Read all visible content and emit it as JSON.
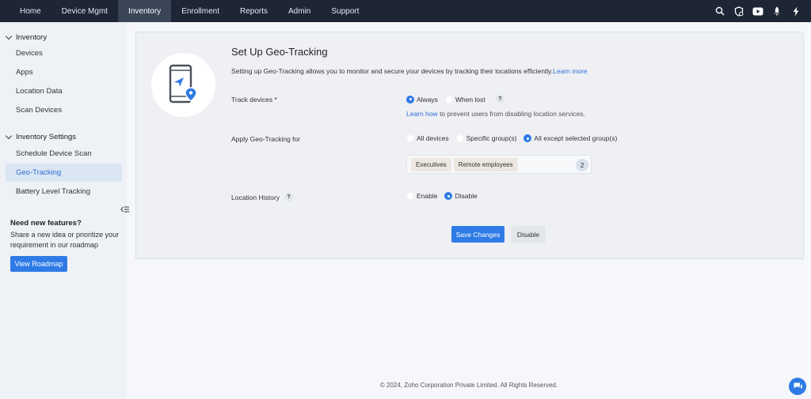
{
  "topnav": {
    "items": [
      {
        "label": "Home"
      },
      {
        "label": "Device Mgmt"
      },
      {
        "label": "Inventory",
        "active": true
      },
      {
        "label": "Enrollment"
      },
      {
        "label": "Reports"
      },
      {
        "label": "Admin"
      },
      {
        "label": "Support"
      }
    ],
    "icons": [
      "search-icon",
      "shield-icon",
      "youtube-icon",
      "rocket-icon",
      "lightning-icon"
    ]
  },
  "sidebar": {
    "inventory_section": "Inventory",
    "inventory_items": [
      "Devices",
      "Apps",
      "Location Data",
      "Scan Devices"
    ],
    "settings_section": "Inventory Settings",
    "settings_items": [
      "Schedule Device Scan",
      "Geo-Tracking",
      "Battery Level Tracking"
    ],
    "active_item": "Geo-Tracking",
    "need_features_title": "Need new features?",
    "need_features_text": "Share a new idea or prioritize your requirement in our roadmap",
    "roadmap_button": "View Roadmap"
  },
  "main": {
    "title": "Set Up Geo-Tracking",
    "description": "Setting up Geo-Tracking allows you to monitor and secure your devices by tracking their locations efficiently.",
    "learn_more": "Learn more",
    "track_devices": {
      "label": "Track devices *",
      "options": [
        "Always",
        "When lost"
      ],
      "selected": "Always",
      "help": "?",
      "hint_link": "Learn how",
      "hint_text": " to prevent users from disabling location services."
    },
    "apply_for": {
      "label": "Apply Geo-Tracking for",
      "options": [
        "All devices",
        "Specific group(s)",
        "All except selected group(s)"
      ],
      "selected": "All except selected group(s)",
      "groups": [
        "Executives",
        "Remote employees"
      ],
      "group_count": "2"
    },
    "location_history": {
      "label": "Location History",
      "help": "?",
      "options": [
        "Enable",
        "Disable"
      ],
      "selected": "Disable"
    },
    "save_button": "Save Changes",
    "disable_button": "Disable"
  },
  "footer": "© 2024, Zoho Corporation Private Limited. All Rights Reserved.",
  "colors": {
    "accent": "#2f7be6",
    "nav_bg": "#1e2636",
    "sidebar_bg": "#eef1f5",
    "active_item_bg": "#dbe6f4"
  }
}
